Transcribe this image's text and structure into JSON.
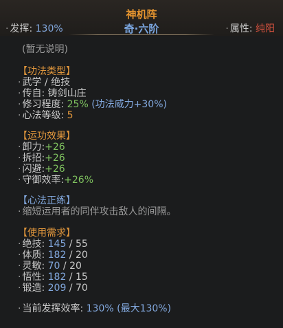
{
  "header": {
    "title": "神机阵",
    "subtitle": "奇·六阶",
    "left_label": "发挥:",
    "left_value": "130%",
    "right_label": "属性:",
    "right_value": "纯阳"
  },
  "description": "(暂无说明)",
  "type_section": {
    "heading": "【功法类型】",
    "line1": "武学 / 绝技",
    "line2": "传自: 铸剑山庄",
    "line3_label": "修习程度:",
    "line3_value": "25%",
    "line3_extra": "(功法威力+30%)",
    "line4_label": "心法等级:",
    "line4_value": "5"
  },
  "effect_section": {
    "heading": "【运功效果】",
    "items": [
      {
        "label": "卸力:",
        "value": "+26"
      },
      {
        "label": "拆招:",
        "value": "+26"
      },
      {
        "label": "闪避:",
        "value": "+26"
      },
      {
        "label": "守御效率:",
        "value": "+26%"
      }
    ]
  },
  "mind_section": {
    "heading": "【心法正练】",
    "text": "缩短运用者的同伴攻击敌人的间隔。"
  },
  "req_section": {
    "heading": "【使用需求】",
    "items": [
      {
        "label": "绝技:",
        "current": "145",
        "required": "55"
      },
      {
        "label": "体质:",
        "current": "182",
        "required": "20"
      },
      {
        "label": "灵敏:",
        "current": "70",
        "required": "20"
      },
      {
        "label": "悟性:",
        "current": "182",
        "required": "15"
      },
      {
        "label": "锻造:",
        "current": "209",
        "required": "70"
      }
    ]
  },
  "footer": {
    "label": "当前发挥效率:",
    "value": "130%",
    "max": "(最大130%)"
  }
}
